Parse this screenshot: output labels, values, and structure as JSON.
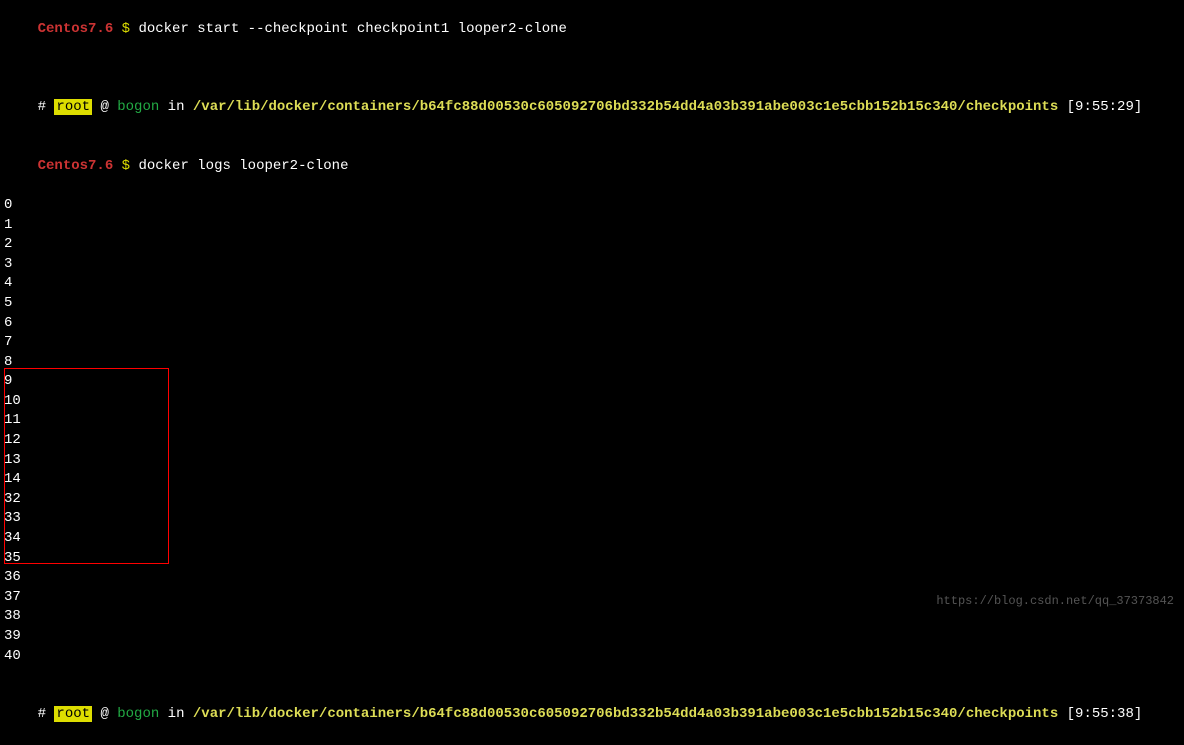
{
  "line1": {
    "prompt": "Centos7.6",
    "dollar": "$",
    "command": "docker start --checkpoint checkpoint1 looper2-clone"
  },
  "line2": {
    "hash": "#",
    "root": "root",
    "at": "@",
    "host": "bogon",
    "in": "in",
    "path": "/var/lib/docker/containers/b64fc88d00530c605092706bd332b54dd4a03b391abe003c1e5cbb152b15c340/checkpoints",
    "time": "[9:55:29]"
  },
  "line3": {
    "prompt": "Centos7.6",
    "dollar": "$",
    "command": "docker logs looper2-clone"
  },
  "output": [
    "0",
    "1",
    "2",
    "3",
    "4",
    "5",
    "6",
    "7",
    "8",
    "9",
    "10",
    "11",
    "12",
    "13",
    "14",
    "32",
    "33",
    "34",
    "35",
    "36",
    "37",
    "38",
    "39",
    "40"
  ],
  "line4": {
    "hash": "#",
    "root": "root",
    "at": "@",
    "host": "bogon",
    "in": "in",
    "path": "/var/lib/docker/containers/b64fc88d00530c605092706bd332b54dd4a03b391abe003c1e5cbb152b15c340/checkpoints",
    "time": "[9:55:38]"
  },
  "watermark": "https://blog.csdn.net/qq_37373842"
}
